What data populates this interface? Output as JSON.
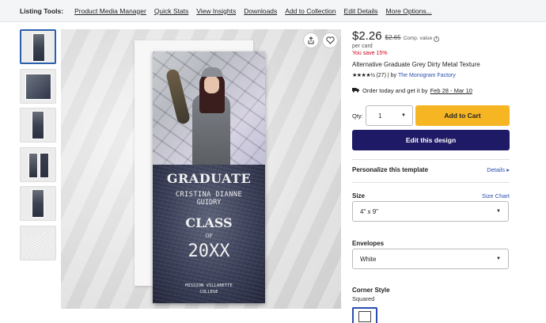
{
  "toolbar": {
    "label": "Listing Tools:",
    "links": [
      "Product Media Manager",
      "Quick Stats",
      "View Insights",
      "Downloads",
      "Add to Collection",
      "Edit Details",
      "More Options..."
    ]
  },
  "card": {
    "graduate": "GRADUATE",
    "name_line1": "CRISTINA DIANNE",
    "name_line2": "GUIDRY",
    "class_word": "CLASS",
    "of_word": "OF",
    "year": "20XX",
    "school_line1": "MISSION VILLABETTE",
    "school_line2": "COLLEGE"
  },
  "product": {
    "price": "$2.26",
    "original_price": "$2.65",
    "comp_value": "Comp. value",
    "per_card": "per card",
    "savings": "You save 15%",
    "title": "Alternative Graduate Grey Dirty Metal Texture",
    "stars": "★★★★½",
    "reviews": "(27) | by",
    "shop": "The Monogram Factory",
    "order_text": "Order today and get it by",
    "order_dates": "Feb 28 - Mar 10"
  },
  "purchase": {
    "qty_label": "Qty:",
    "qty_value": "1",
    "add_to_cart": "Add to Cart",
    "edit_design": "Edit this design"
  },
  "options": {
    "personalize_label": "Personalize this template",
    "personalize_link": "Details ▸",
    "size_label": "Size",
    "size_chart": "Size Chart",
    "size_value": "4\" x 9\"",
    "envelopes_label": "Envelopes",
    "envelopes_value": "White",
    "corner_label": "Corner Style",
    "corner_value": "Squared"
  },
  "colors": {
    "accent_blue": "#2b4fae",
    "cart_yellow": "#f6b623",
    "edit_navy": "#1e1a66",
    "sale_red": "#d0021b"
  }
}
